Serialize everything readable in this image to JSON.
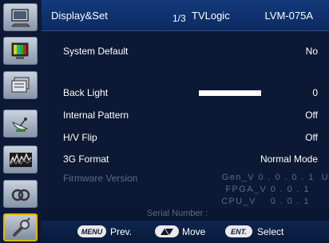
{
  "header": {
    "title": "Display&Set",
    "page": "1/3",
    "brand": "TVLogic",
    "model": "LVM-075A"
  },
  "sidebar": {
    "icons": [
      "monitor-icon",
      "color-bars-icon",
      "window-panel-icon",
      "satellite-dish-icon",
      "waveform-icon",
      "audio-link-icon",
      "tools-icon"
    ],
    "active_index": 6
  },
  "menu": {
    "system_default": {
      "label": "System Default",
      "value": "No"
    },
    "back_light": {
      "label": "Back Light",
      "value": "0",
      "level": 0.6
    },
    "internal_pattern": {
      "label": "Internal Pattern",
      "value": "Off"
    },
    "hv_flip": {
      "label": "H/V Flip",
      "value": "Off"
    },
    "format_3g": {
      "label": "3G Format",
      "value": "Normal Mode"
    },
    "firmware": {
      "label": "Firmware Version",
      "gen": "Gen_V 0 . 0 . 0 . 1  U",
      "fpga": "FPGA_V 0 . 0 . 1",
      "cpu": "CPU_V    0 . 0 . 1"
    },
    "serial_label": "Serial Number :"
  },
  "footer": {
    "menu_key": "MENU",
    "prev": "Prev.",
    "move": "Move",
    "ent_key": "ENT.",
    "select": "Select"
  }
}
